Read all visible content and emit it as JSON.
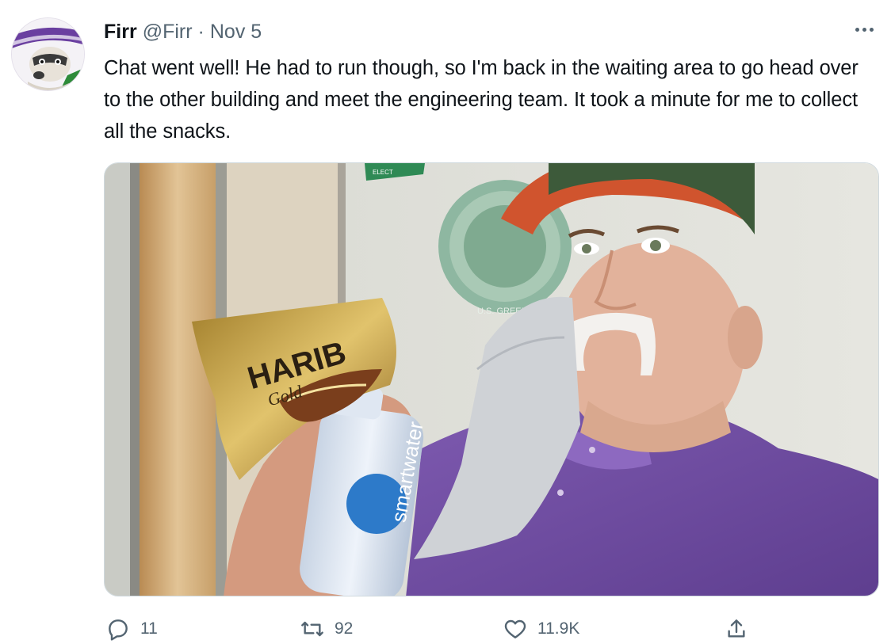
{
  "tweet": {
    "display_name": "Firr",
    "handle": "@Firr",
    "separator": "·",
    "date": "Nov 5",
    "text": "Chat went well! He had to run though, so I'm back in the waiting area to go head over to the other building and meet the engineering team. It took a minute for me to collect all the snacks.",
    "more_icon": "more-horizontal-icon",
    "avatar_icon": "raccoon-avatar"
  },
  "media": {
    "photo_text": {
      "wall_sign": "ELECT",
      "snack_brand": "HARIB",
      "snack_variant": "Gold",
      "bottle_label": "smartwater",
      "seal": "U.S. GREEN ... 2010"
    }
  },
  "actions": {
    "reply_count": "11",
    "retweet_count": "92",
    "like_count": "11.9K",
    "reply_icon": "reply-icon",
    "retweet_icon": "retweet-icon",
    "like_icon": "heart-icon",
    "share_icon": "share-icon"
  },
  "colors": {
    "text_primary": "#0f1419",
    "text_secondary": "#536471",
    "border": "#cfd9de"
  }
}
